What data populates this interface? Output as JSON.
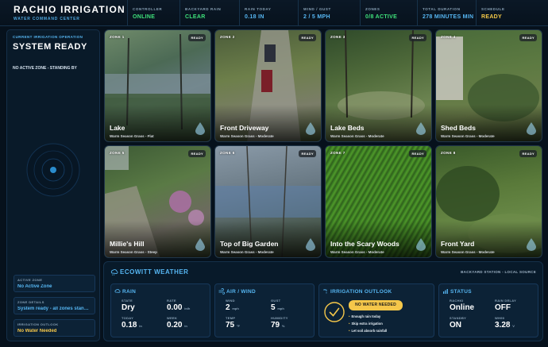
{
  "header": {
    "title": "RACHIO IRRIGATION",
    "subtitle": "WATER COMMAND CENTER",
    "stats": [
      {
        "label": "CONTROLLER",
        "value": "ONLINE",
        "tone": "green"
      },
      {
        "label": "BACKYARD RAIN",
        "value": "CLEAR",
        "tone": "green"
      },
      {
        "label": "RAIN TODAY",
        "value": "0.18 IN",
        "tone": "blue"
      },
      {
        "label": "WIND / GUST",
        "value": "2 / 5 MPH",
        "tone": "blue"
      },
      {
        "label": "ZONES",
        "value": "0/8 ACTIVE",
        "tone": "green"
      },
      {
        "label": "TOTAL DURATION",
        "value": "278 MINUTES MIN",
        "tone": "blue"
      },
      {
        "label": "SCHEDULE",
        "value": "READY",
        "tone": "yellow"
      }
    ]
  },
  "operation": {
    "label": "CURRENT IRRIGATION OPERATION",
    "title": "SYSTEM READY",
    "subtitle": "NO ACTIVE ZONE - STANDING BY",
    "active_zone_label": "ACTIVE ZONE",
    "active_zone_value": "No Active Zone",
    "zone_details_label": "ZONE DETAILS",
    "zone_details_value": "System ready - all zones standing by",
    "outlook_label": "IRRIGATION OUTLOOK",
    "outlook_value": "No Water Needed"
  },
  "zones": [
    {
      "tag": "ZONE 1",
      "status": "READY",
      "name": "Lake",
      "type": "Warm Season Grass - Flat"
    },
    {
      "tag": "ZONE 2",
      "status": "READY",
      "name": "Front Driveway",
      "type": "Warm Season Grass - Moderate"
    },
    {
      "tag": "ZONE 3",
      "status": "READY",
      "name": "Lake Beds",
      "type": "Warm Season Grass - Moderate"
    },
    {
      "tag": "ZONE 4",
      "status": "READY",
      "name": "Shed Beds",
      "type": "Warm Season Grass - Moderate"
    },
    {
      "tag": "ZONE 5",
      "status": "READY",
      "name": "Millie's Hill",
      "type": "Warm Season Grass - Steep"
    },
    {
      "tag": "ZONE 6",
      "status": "READY",
      "name": "Top of Big Garden",
      "type": "Warm Season Grass - Moderate"
    },
    {
      "tag": "ZONE 7",
      "status": "READY",
      "name": "Into the Scary Woods",
      "type": "Warm Season Grass - Moderate"
    },
    {
      "tag": "ZONE 8",
      "status": "READY",
      "name": "Front Yard",
      "type": "Warm Season Grass - Moderate"
    }
  ],
  "weather": {
    "title": "ECOWITT WEATHER",
    "source": "BACKYARD STATION - LOCAL SOURCE",
    "rain": {
      "title": "RAIN",
      "state_label": "STATE",
      "state_value": "Dry",
      "rate_label": "RATE",
      "rate_value": "0.00",
      "rate_unit": "in/h",
      "today_label": "TODAY",
      "today_value": "0.18",
      "today_unit": "in",
      "week_label": "WEEK",
      "week_value": "0.20",
      "week_unit": "in"
    },
    "air": {
      "title": "AIR / WIND",
      "wind_label": "WIND",
      "wind_value": "2",
      "wind_unit": "mph",
      "gust_label": "GUST",
      "gust_value": "5",
      "gust_unit": "mph",
      "temp_label": "TEMP",
      "temp_value": "75",
      "temp_unit": "°F",
      "humidity_label": "HUMIDITY",
      "humidity_value": "79",
      "humidity_unit": "%"
    },
    "outlook": {
      "title": "IRRIGATION OUTLOOK",
      "button": "NO WATER NEEDED",
      "bullets": [
        "Enough rain today",
        "Skip extra irrigation",
        "Let soil absorb rainfall"
      ]
    },
    "status": {
      "title": "STATUS",
      "rachio_label": "RACHIO",
      "rachio_value": "Online",
      "delay_label": "RAIN DELAY",
      "delay_value": "OFF",
      "standby_label": "STANDBY",
      "standby_value": "ON",
      "wh_label": "WH90",
      "wh_value": "3.28",
      "wh_unit": "V"
    }
  },
  "colors": {
    "accent": "#56b6f2",
    "ok": "#3ee07a",
    "warn": "#f5c74a",
    "bg": "#06111c"
  }
}
